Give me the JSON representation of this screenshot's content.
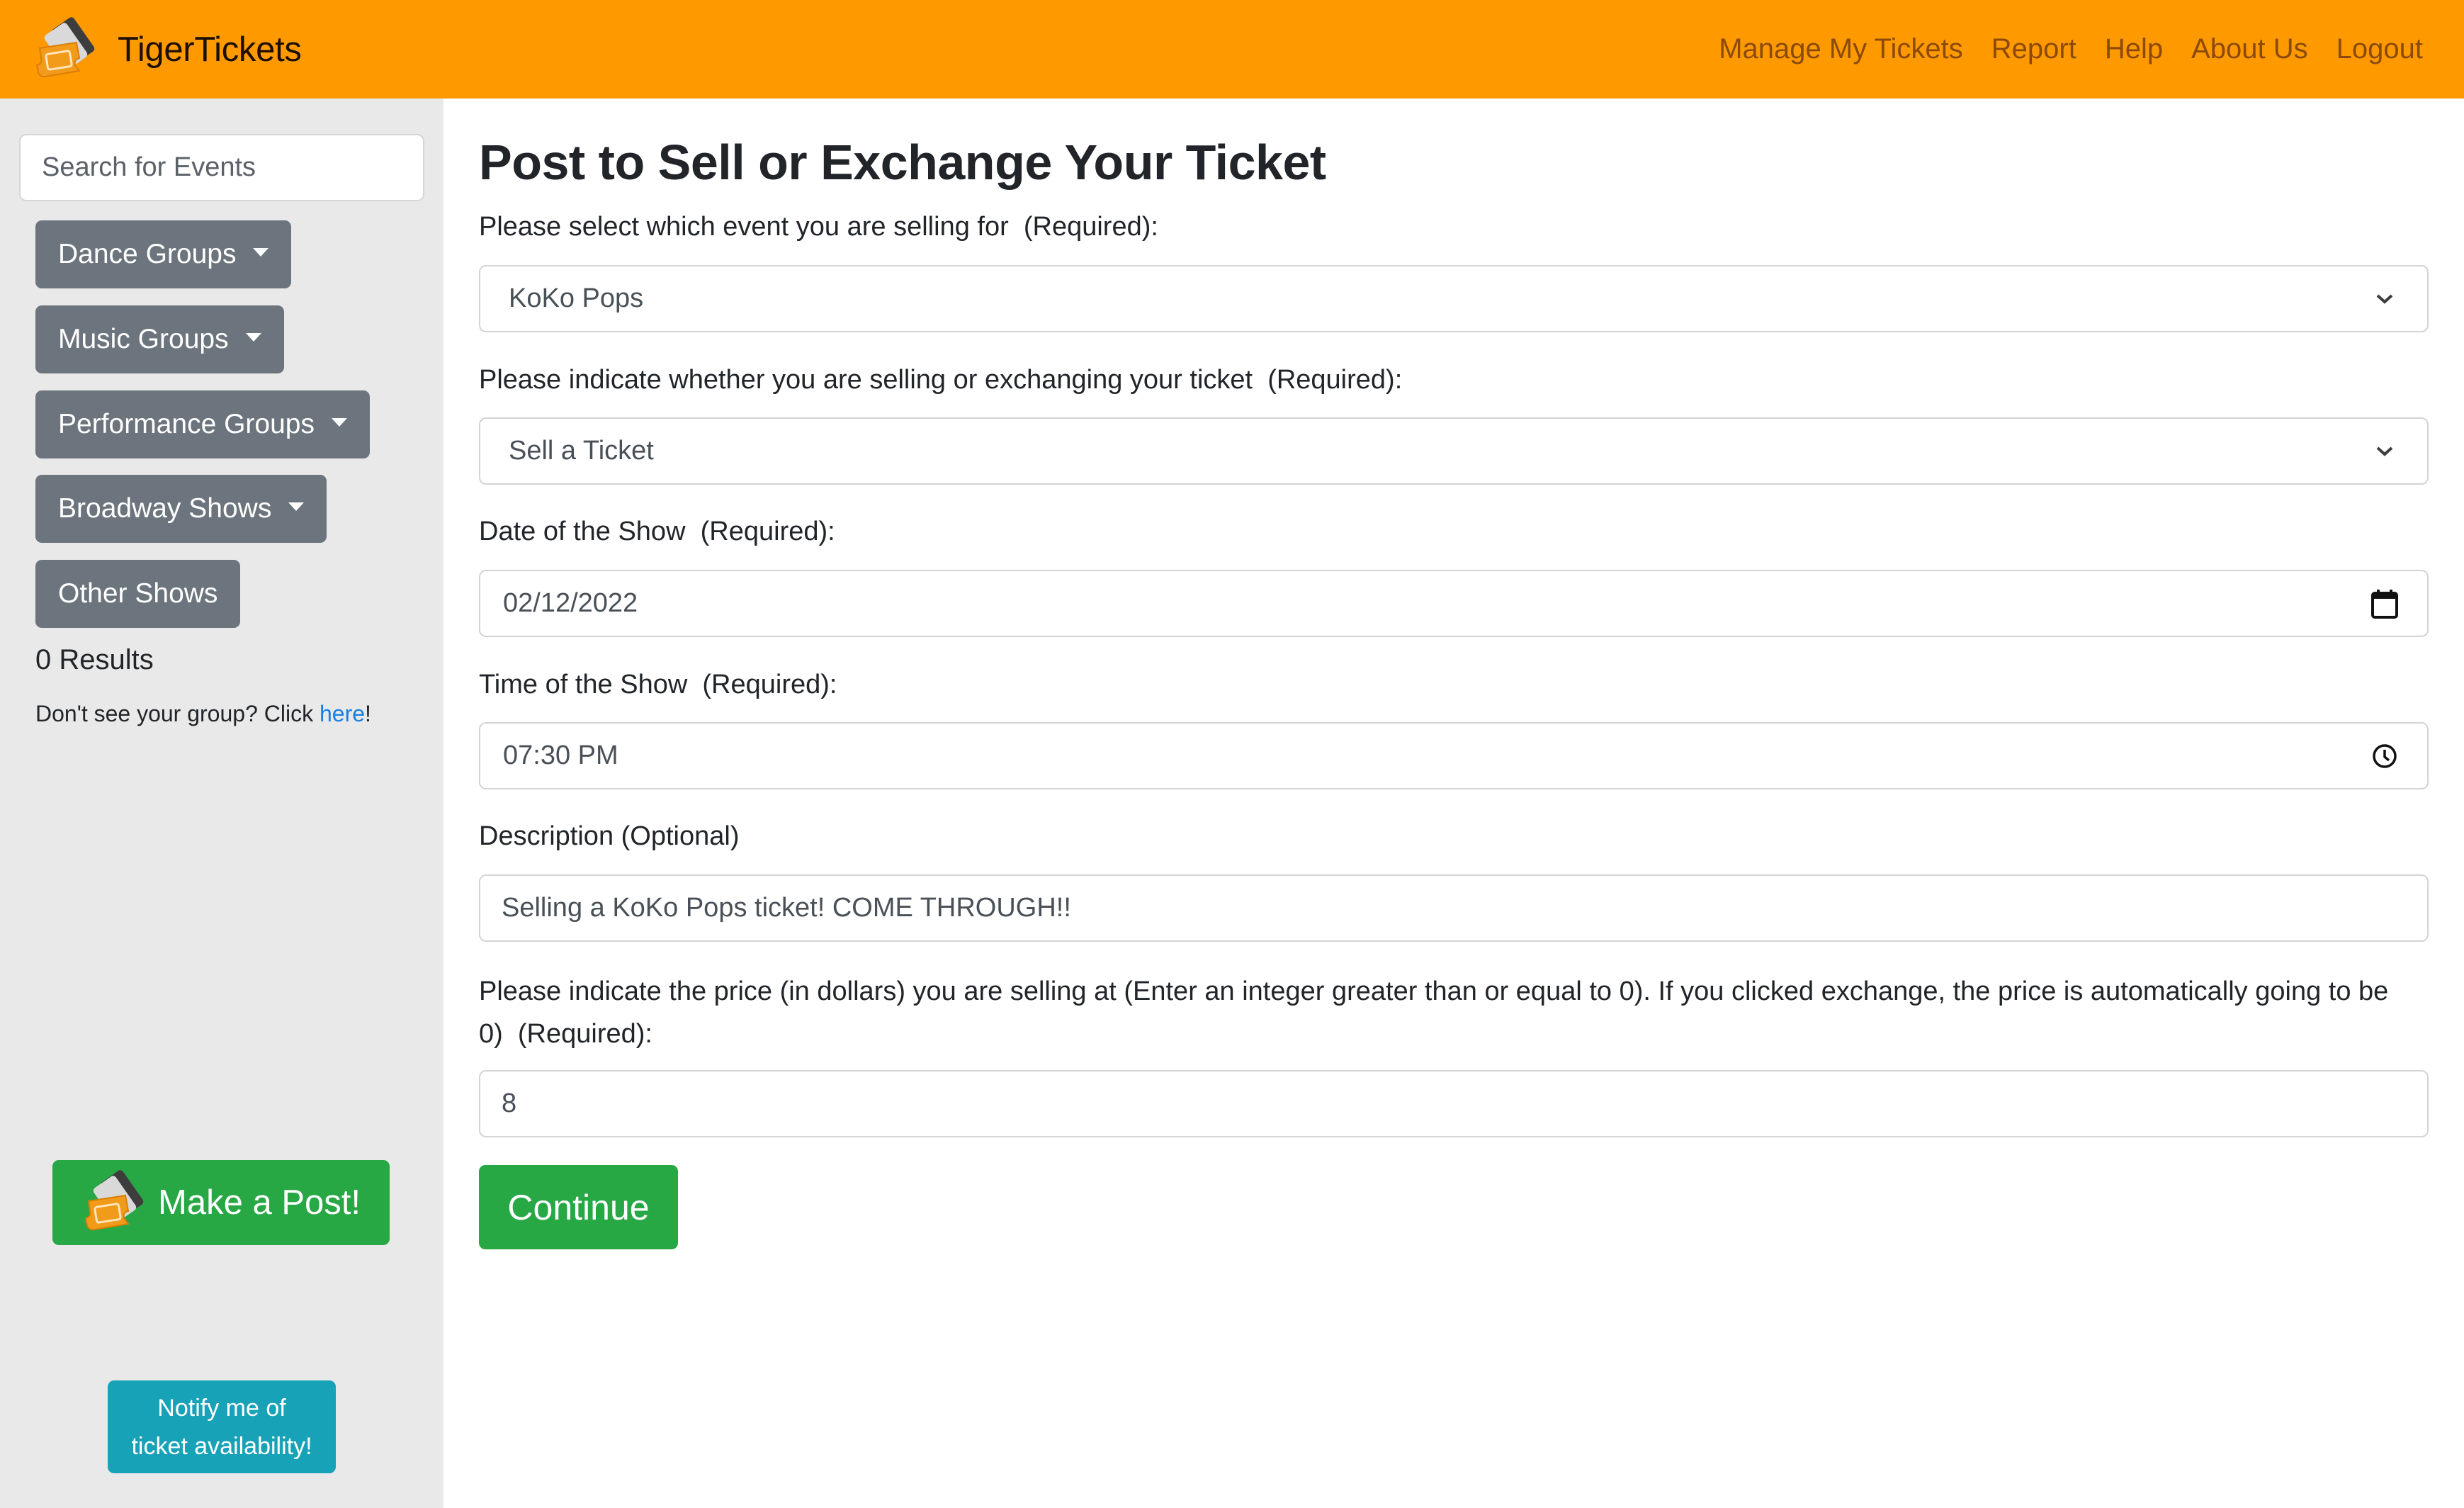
{
  "navbar": {
    "brand": "TigerTickets",
    "brand_icon": "ticket-stack-icon",
    "links": [
      "Manage My Tickets",
      "Report",
      "Help",
      "About Us",
      "Logout"
    ],
    "bg_color": "#ff9900"
  },
  "sidebar": {
    "search_placeholder": "Search for Events",
    "categories": [
      {
        "label": "Dance Groups",
        "dropdown": true
      },
      {
        "label": "Music Groups",
        "dropdown": true
      },
      {
        "label": "Performance Groups",
        "dropdown": true
      },
      {
        "label": "Broadway Shows",
        "dropdown": true
      },
      {
        "label": "Other Shows",
        "dropdown": false
      }
    ],
    "results": "0 Results",
    "hint_text": "Don't see your group? Click ",
    "hint_link": "here",
    "hint_suffix": "!",
    "make_post": "Make a Post!",
    "notify_line1": "Notify me of",
    "notify_line2": "ticket availability!"
  },
  "form": {
    "title": "Post to Sell or Exchange Your Ticket",
    "event_label": "Please select which event you are selling for  (Required):",
    "event_value": "KoKo Pops",
    "type_label": "Please indicate whether you are selling or exchanging your ticket  (Required):",
    "type_value": "Sell a Ticket",
    "date_label": "Date of the Show  (Required):",
    "date_value": "02/12/2022",
    "time_label": "Time of the Show  (Required):",
    "time_value": "07:30 PM",
    "desc_label": "Description (Optional)",
    "desc_value": "Selling a KoKo Pops ticket! COME THROUGH!!",
    "price_label": "Please indicate the price (in dollars) you are selling at (Enter an integer greater than or equal to 0). If you clicked exchange, the price is automatically going to be 0)  (Required):",
    "price_value": "8",
    "continue": "Continue"
  },
  "colors": {
    "primary_green": "#28a745",
    "info_teal": "#17a2b8",
    "secondary_gray": "#6c757d",
    "link_blue": "#1a7fe0"
  }
}
